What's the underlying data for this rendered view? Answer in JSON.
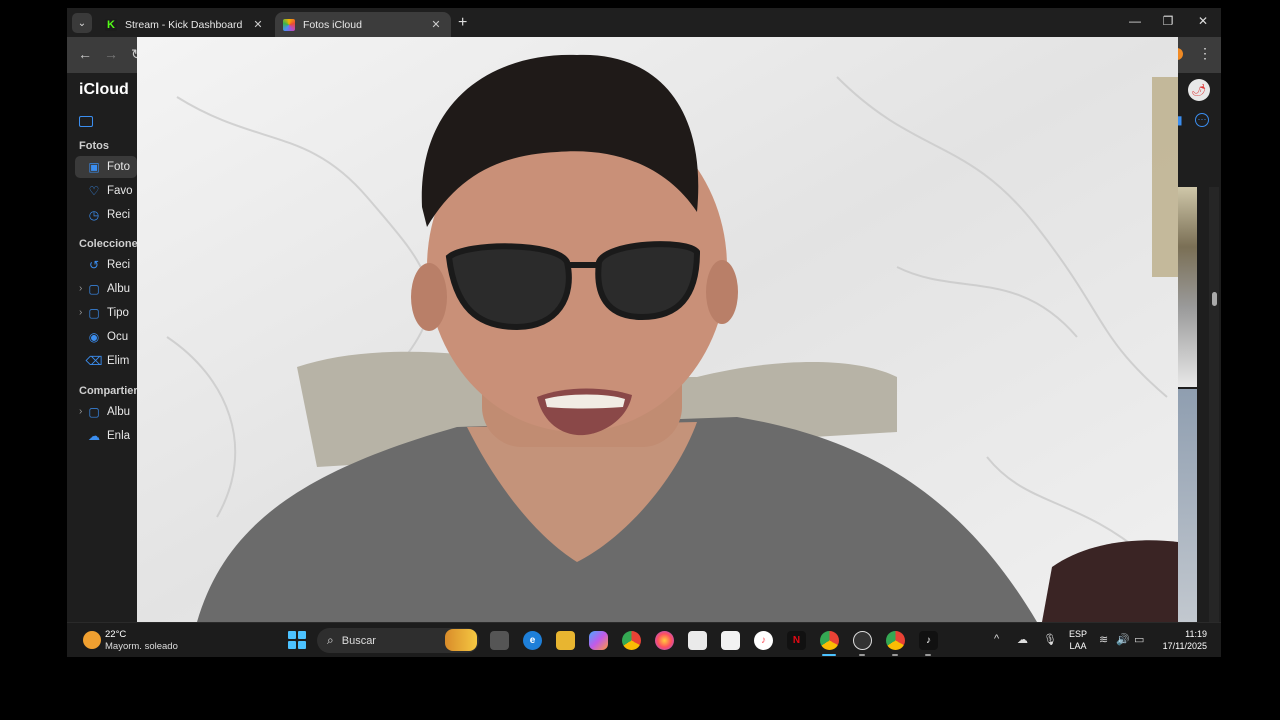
{
  "browser": {
    "tabs": [
      {
        "title": "Stream - Kick Dashboard",
        "favicon": "kick-icon",
        "active": false
      },
      {
        "title": "Fotos iCloud",
        "favicon": "photos-icon",
        "active": true
      }
    ],
    "newtab_glyph": "+",
    "tab_close_glyph": "✕"
  },
  "icloud": {
    "logo_text": "iCloud",
    "sidebar": {
      "section_photos": "Fotos",
      "section_collections": "Coleccione",
      "section_shared": "Compartier",
      "items": [
        {
          "label": "Foto",
          "icon": "photos-icon",
          "selected": true
        },
        {
          "label": "Favo",
          "icon": "heart-icon",
          "selected": false
        },
        {
          "label": "Reci",
          "icon": "clock-icon",
          "selected": false
        },
        {
          "label": "Reci",
          "icon": "recent-icon",
          "selected": false
        },
        {
          "label": "Álbu",
          "icon": "album-icon",
          "selected": false
        },
        {
          "label": "Tipo",
          "icon": "album-icon",
          "selected": false
        },
        {
          "label": "Ocu",
          "icon": "eye-icon",
          "selected": false
        },
        {
          "label": "Elim",
          "icon": "trash-icon",
          "selected": false
        },
        {
          "label": "Álbu",
          "icon": "shared-album-icon",
          "selected": false
        },
        {
          "label": "Enla",
          "icon": "cloud-link-icon",
          "selected": false
        }
      ]
    }
  },
  "taskbar": {
    "weather_temp": "22°C",
    "weather_desc": "Mayorm. soleado",
    "search_placeholder": "Buscar",
    "lang_line1": "ESP",
    "lang_line2": "LAA",
    "time": "11:19",
    "date": "17/11/2025"
  },
  "colors": {
    "accent": "#3b8ef0",
    "kick_green": "#53fc18",
    "taskbar_bg": "#1c1c1c"
  }
}
